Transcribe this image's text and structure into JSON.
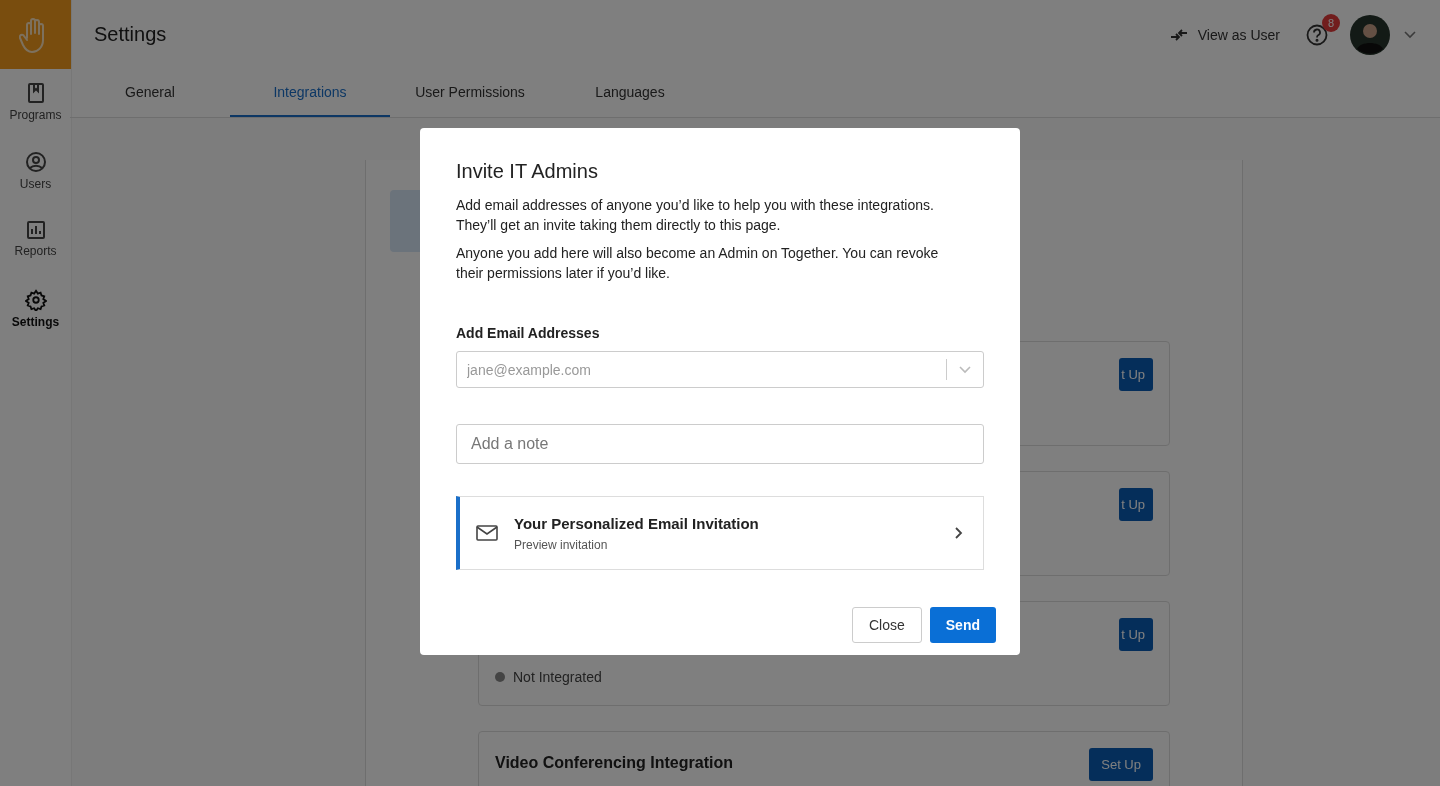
{
  "header": {
    "title": "Settings",
    "view_as_user": "View as User",
    "help_badge": "8"
  },
  "sidebar": {
    "items": [
      {
        "label": "Programs",
        "selected": false
      },
      {
        "label": "Users",
        "selected": false
      },
      {
        "label": "Reports",
        "selected": false
      },
      {
        "label": "Settings",
        "selected": true
      }
    ]
  },
  "tabs": [
    {
      "label": "General",
      "selected": false
    },
    {
      "label": "Integrations",
      "selected": true
    },
    {
      "label": "User Permissions",
      "selected": false
    },
    {
      "label": "Languages",
      "selected": false
    }
  ],
  "cards": [
    {
      "button": "t Up"
    },
    {
      "button": "t Up"
    },
    {
      "button": "t Up",
      "status": "Not Integrated"
    },
    {
      "title": "Video Conferencing Integration",
      "button": "Set Up"
    }
  ],
  "modal": {
    "title": "Invite IT Admins",
    "paragraphs": [
      "Add email addresses of anyone you’d like to help you with these integrations. They’ll get an invite taking them directly to this page.",
      "Anyone you add here will also become an Admin on Together. You can revoke their permissions later if you’d like."
    ],
    "email_label": "Add Email Addresses",
    "email_placeholder": "jane@example.com",
    "note_placeholder": "Add a note",
    "invitation": {
      "title": "Your Personalized Email Invitation",
      "subtitle": "Preview invitation"
    },
    "buttons": {
      "close": "Close",
      "send": "Send"
    }
  }
}
